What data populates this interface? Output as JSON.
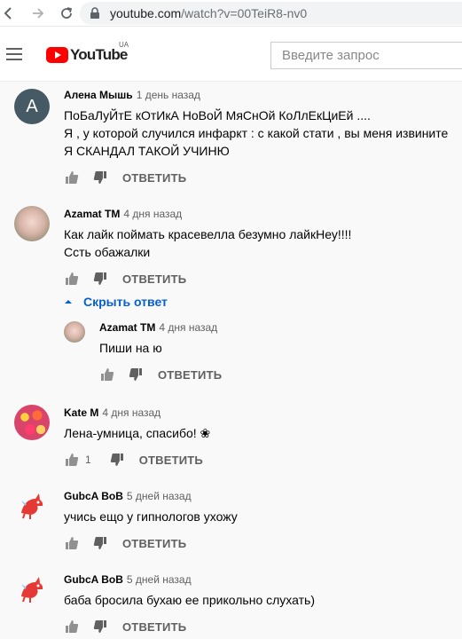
{
  "browser": {
    "url_host": "youtube.com",
    "url_path": "/watch?v=00TeiR8-nv0"
  },
  "header": {
    "logo_text": "YouTube",
    "logo_region": "UA",
    "search_placeholder": "Введите запрос"
  },
  "comments": [
    {
      "author": "Алена Мышь",
      "time": "1 день назад",
      "avatar_letter": "A",
      "lines": [
        "ПоБаЛуЙтЕ кОтИкА НоВоЙ МяСнОй КоЛлЕкЦиЕй ....",
        "Я ,  у которой случился инфаркт : с какой стати , вы меня извините",
        "Я СКАНДАЛ ТАКОЙ УЧИНЮ"
      ],
      "reply_label": "ОТВЕТИТЬ"
    },
    {
      "author": "Azamat TM",
      "time": "4 дня назад",
      "lines": [
        "Как лайк поймать красевелла безумно лайкНеу!!!!",
        "Ссть обажалки"
      ],
      "reply_label": "ОТВЕТИТЬ",
      "hide_replies_label": "Скрыть ответ"
    },
    {
      "author": "Azamat TM",
      "time": "4 дня назад",
      "lines": [
        "Пиши на ю"
      ],
      "reply_label": "ОТВЕТИТЬ"
    },
    {
      "author": "Kate M",
      "time": "4 дня назад",
      "lines": [
        "Лена-умница, спасибо! ❀"
      ],
      "likes": "1",
      "reply_label": "ОТВЕТИТЬ"
    },
    {
      "author": "GubcA BoB",
      "time": "5 дней назад",
      "lines": [
        "учись ещо у гипнологов ухожу"
      ],
      "reply_label": "ОТВЕТИТЬ"
    },
    {
      "author": "GubcA BoB",
      "time": "5 дней назад",
      "lines": [
        "баба бросила бухаю ее прикольно слухать)"
      ],
      "reply_label": "ОТВЕТИТЬ"
    }
  ],
  "colors": {
    "accent_blue": "#065fd4",
    "brand_red": "#ff0000",
    "letter_avatar_bg": "#455a64"
  }
}
